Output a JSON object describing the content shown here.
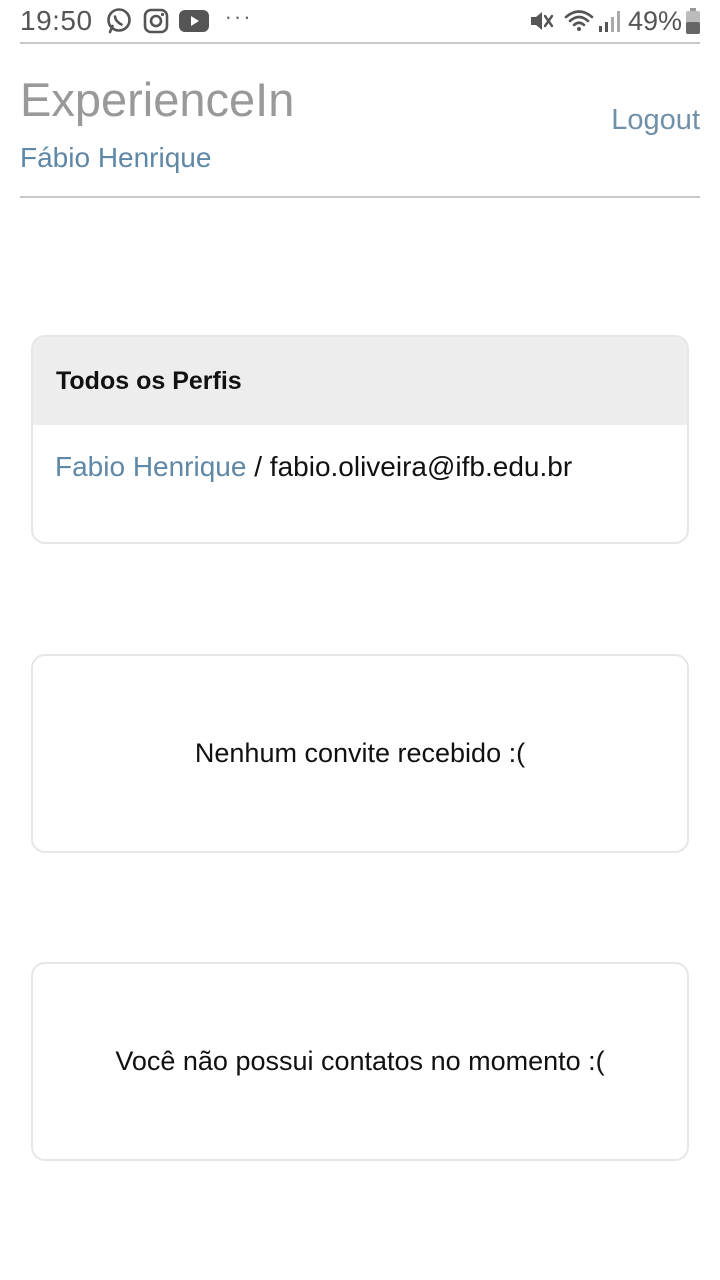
{
  "status_bar": {
    "time": "19:50",
    "battery": "49%",
    "notification_icons": [
      "whatsapp-icon",
      "instagram-icon",
      "youtube-icon"
    ],
    "more": "···"
  },
  "header": {
    "brand": "ExperienceIn",
    "user_name": "Fábio Henrique",
    "logout_label": "Logout"
  },
  "profiles_card": {
    "title": "Todos os Perfis",
    "items": [
      {
        "name": "Fabio Henrique",
        "separator": " / ",
        "email": "fabio.oliveira@ifb.edu.br"
      }
    ]
  },
  "invites_card": {
    "empty_text": "Nenhum convite recebido :("
  },
  "contacts_card": {
    "empty_text": "Você não possui contatos no momento :("
  },
  "colors": {
    "brand_gray": "#999999",
    "link_blue": "#5f87a6",
    "card_header_bg": "#ededed"
  }
}
